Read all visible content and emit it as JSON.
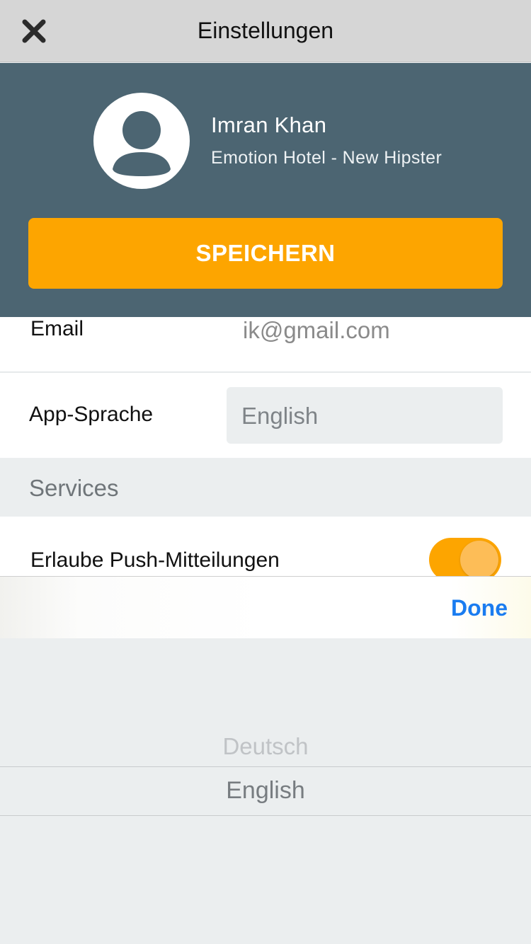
{
  "navbar": {
    "title": "Einstellungen",
    "close_icon": "close-icon"
  },
  "profile": {
    "avatar_icon": "user-avatar-icon",
    "name": "Imran Khan",
    "hotel": "Emotion Hotel - New Hipster",
    "save_label": "SPEICHERN"
  },
  "form": {
    "email_label": "Email",
    "email_value": "ik@gmail.com",
    "language_label": "App-Sprache",
    "language_value": "English",
    "services_header": "Services",
    "push_label": "Erlaube Push-Mitteilungen",
    "push_enabled": true
  },
  "picker": {
    "done_label": "Done",
    "options": [
      "Deutsch",
      "English"
    ],
    "selected": "English"
  },
  "colors": {
    "accent": "#fda500",
    "header_bg": "#4c6572",
    "link_blue": "#1a7cf0"
  }
}
